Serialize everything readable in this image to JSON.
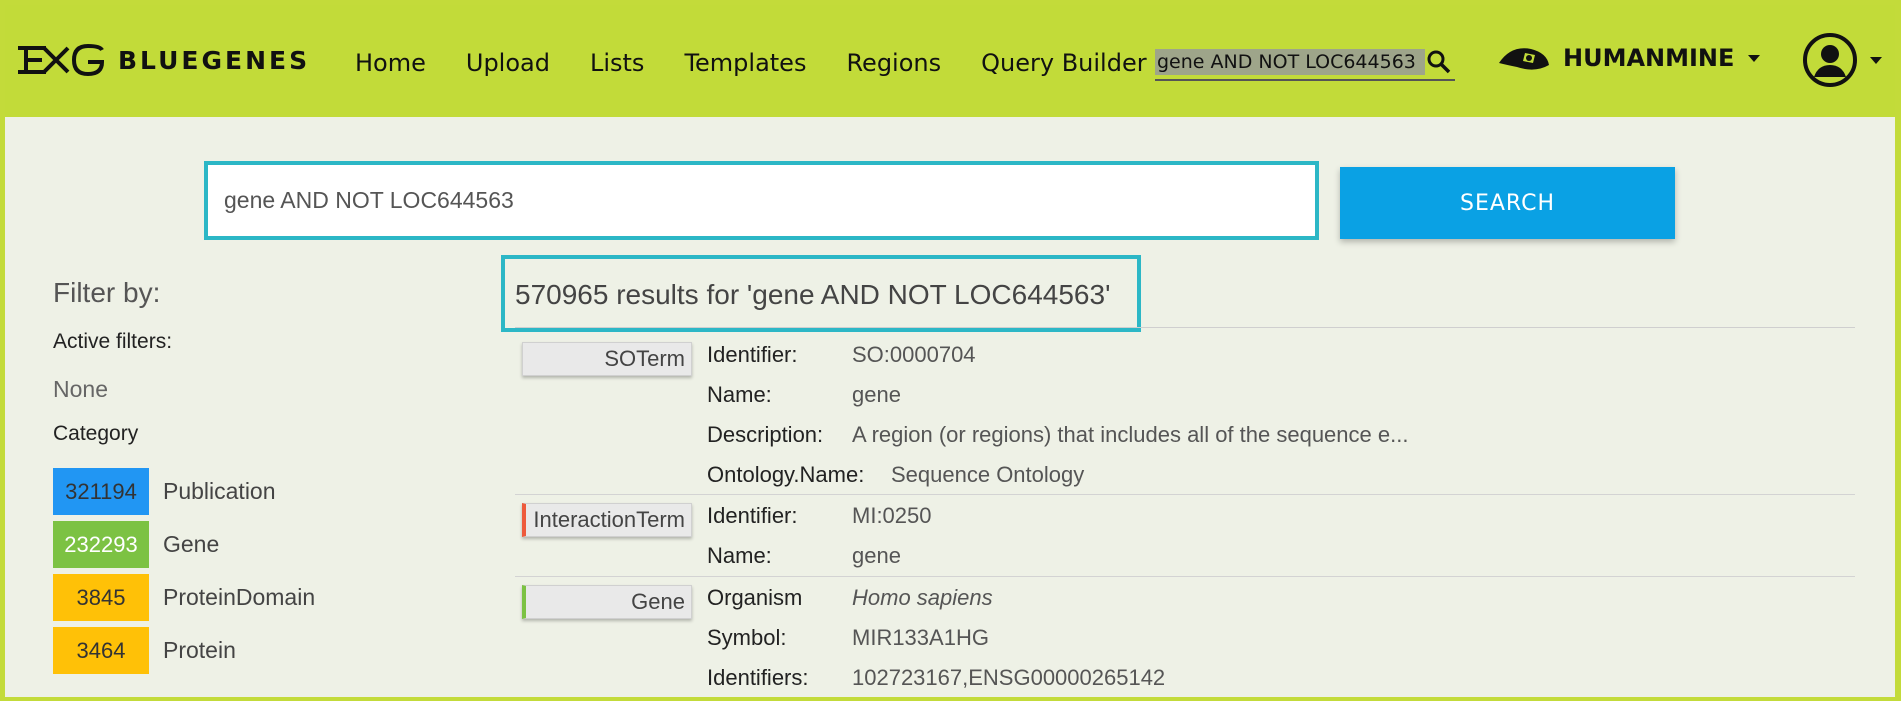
{
  "navbar": {
    "logo_text": "BLUEGENES",
    "links": [
      "Home",
      "Upload",
      "Lists",
      "Templates",
      "Regions",
      "Query Builder"
    ],
    "search_value": "gene AND NOT LOC644563",
    "mine_name": "HUMANMINE"
  },
  "search": {
    "value": "gene AND NOT LOC644563",
    "button_label": "SEARCH"
  },
  "filters": {
    "title": "Filter by:",
    "active_label": "Active filters:",
    "active_value": "None",
    "category_label": "Category",
    "categories": [
      {
        "count": "321194",
        "name": "Publication",
        "color": "#2196f3"
      },
      {
        "count": "232293",
        "name": "Gene",
        "color": "#7cc243"
      },
      {
        "count": "3845",
        "name": "ProteinDomain",
        "color": "#ffc107"
      },
      {
        "count": "3464",
        "name": "Protein",
        "color": "#ffc107"
      }
    ]
  },
  "results": {
    "header": "570965 results for 'gene AND NOT LOC644563'",
    "items": [
      {
        "type": "SOTerm",
        "accent": "none",
        "fields": [
          {
            "label": "Identifier:",
            "value": "SO:0000704"
          },
          {
            "label": "Name:",
            "value": "gene"
          },
          {
            "label": "Description:",
            "value": "A region (or regions) that includes all of the sequence e..."
          },
          {
            "label": "Ontology.Name:",
            "value": "Sequence Ontology"
          }
        ]
      },
      {
        "type": "InteractionTerm",
        "accent": "#ee5a3c",
        "fields": [
          {
            "label": "Identifier:",
            "value": "MI:0250"
          },
          {
            "label": "Name:",
            "value": "gene"
          }
        ]
      },
      {
        "type": "Gene",
        "accent": "#7cc243",
        "fields": [
          {
            "label": "Organism",
            "value": "Homo sapiens"
          },
          {
            "label": "Symbol:",
            "value": "MIR133A1HG"
          },
          {
            "label": "Identifiers:",
            "value": "102723167,ENSG00000265142"
          }
        ]
      }
    ]
  }
}
